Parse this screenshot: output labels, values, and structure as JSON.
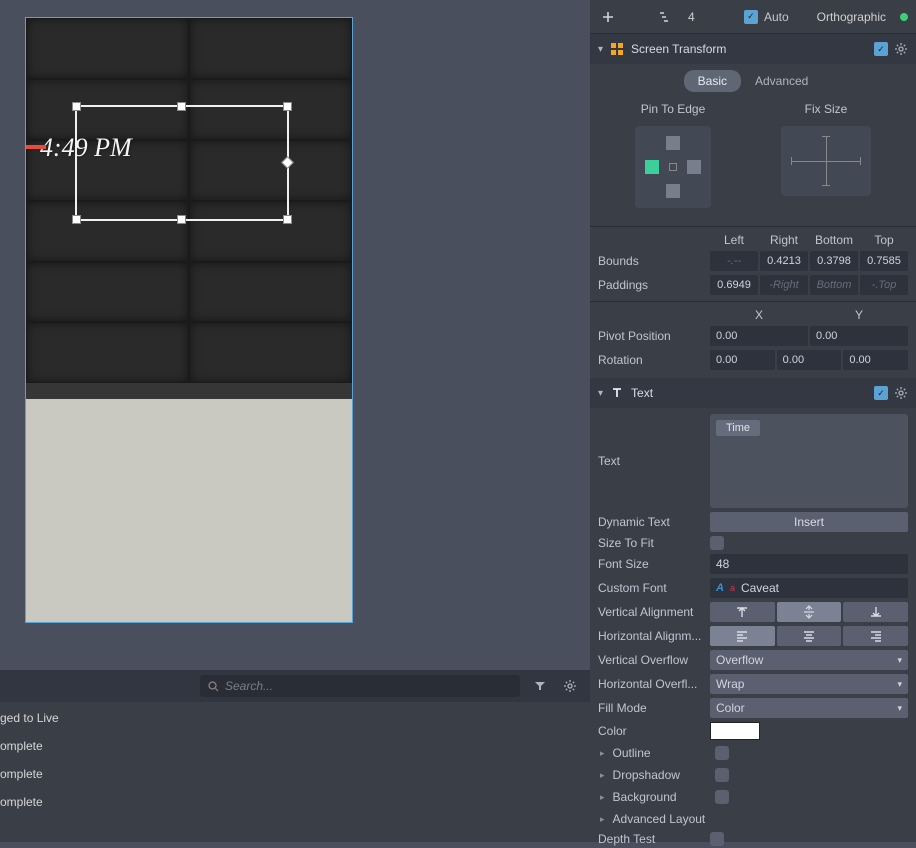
{
  "viewport": {
    "time_text": "4:49 PM"
  },
  "log": {
    "search_placeholder": "Search...",
    "lines": [
      "ged to Live",
      "omplete",
      "omplete",
      "omplete"
    ]
  },
  "toolbar": {
    "level": "4",
    "auto_label": "Auto",
    "projection": "Orthographic"
  },
  "screen_transform": {
    "title": "Screen Transform",
    "mode_basic": "Basic",
    "mode_advanced": "Advanced",
    "pin_label": "Pin To Edge",
    "fixsize_label": "Fix Size",
    "col_left": "Left",
    "col_right": "Right",
    "col_bottom": "Bottom",
    "col_top": "Top",
    "bounds_label": "Bounds",
    "bounds": {
      "left": "-.--",
      "right": "0.4213",
      "bottom": "0.3798",
      "top": "0.7585"
    },
    "paddings_label": "Paddings",
    "paddings": {
      "left": "0.6949",
      "right": "-Right",
      "bottom": "Bottom",
      "top": "-.Top"
    },
    "col_x": "X",
    "col_y": "Y",
    "pivot_label": "Pivot Position",
    "pivot": {
      "x": "0.00",
      "y": "0.00"
    },
    "rotation_label": "Rotation",
    "rotation": {
      "x": "0.00",
      "y": "0.00",
      "z": "0.00"
    }
  },
  "text_comp": {
    "title": "Text",
    "text_label": "Text",
    "text_token": "Time",
    "dynamic_label": "Dynamic Text",
    "insert_btn": "Insert",
    "size_fit_label": "Size To Fit",
    "font_size_label": "Font Size",
    "font_size": "48",
    "custom_font_label": "Custom Font",
    "custom_font": "Caveat",
    "valign_label": "Vertical Alignment",
    "halign_label": "Horizontal Alignm...",
    "voverflow_label": "Vertical Overflow",
    "voverflow": "Overflow",
    "hoverflow_label": "Horizontal Overfl...",
    "hoverflow": "Wrap",
    "fill_label": "Fill Mode",
    "fill_mode": "Color",
    "color_label": "Color",
    "color": "#ffffff",
    "outline_label": "Outline",
    "dropshadow_label": "Dropshadow",
    "background_label": "Background",
    "adv_layout_label": "Advanced Layout",
    "depth_label": "Depth Test"
  }
}
